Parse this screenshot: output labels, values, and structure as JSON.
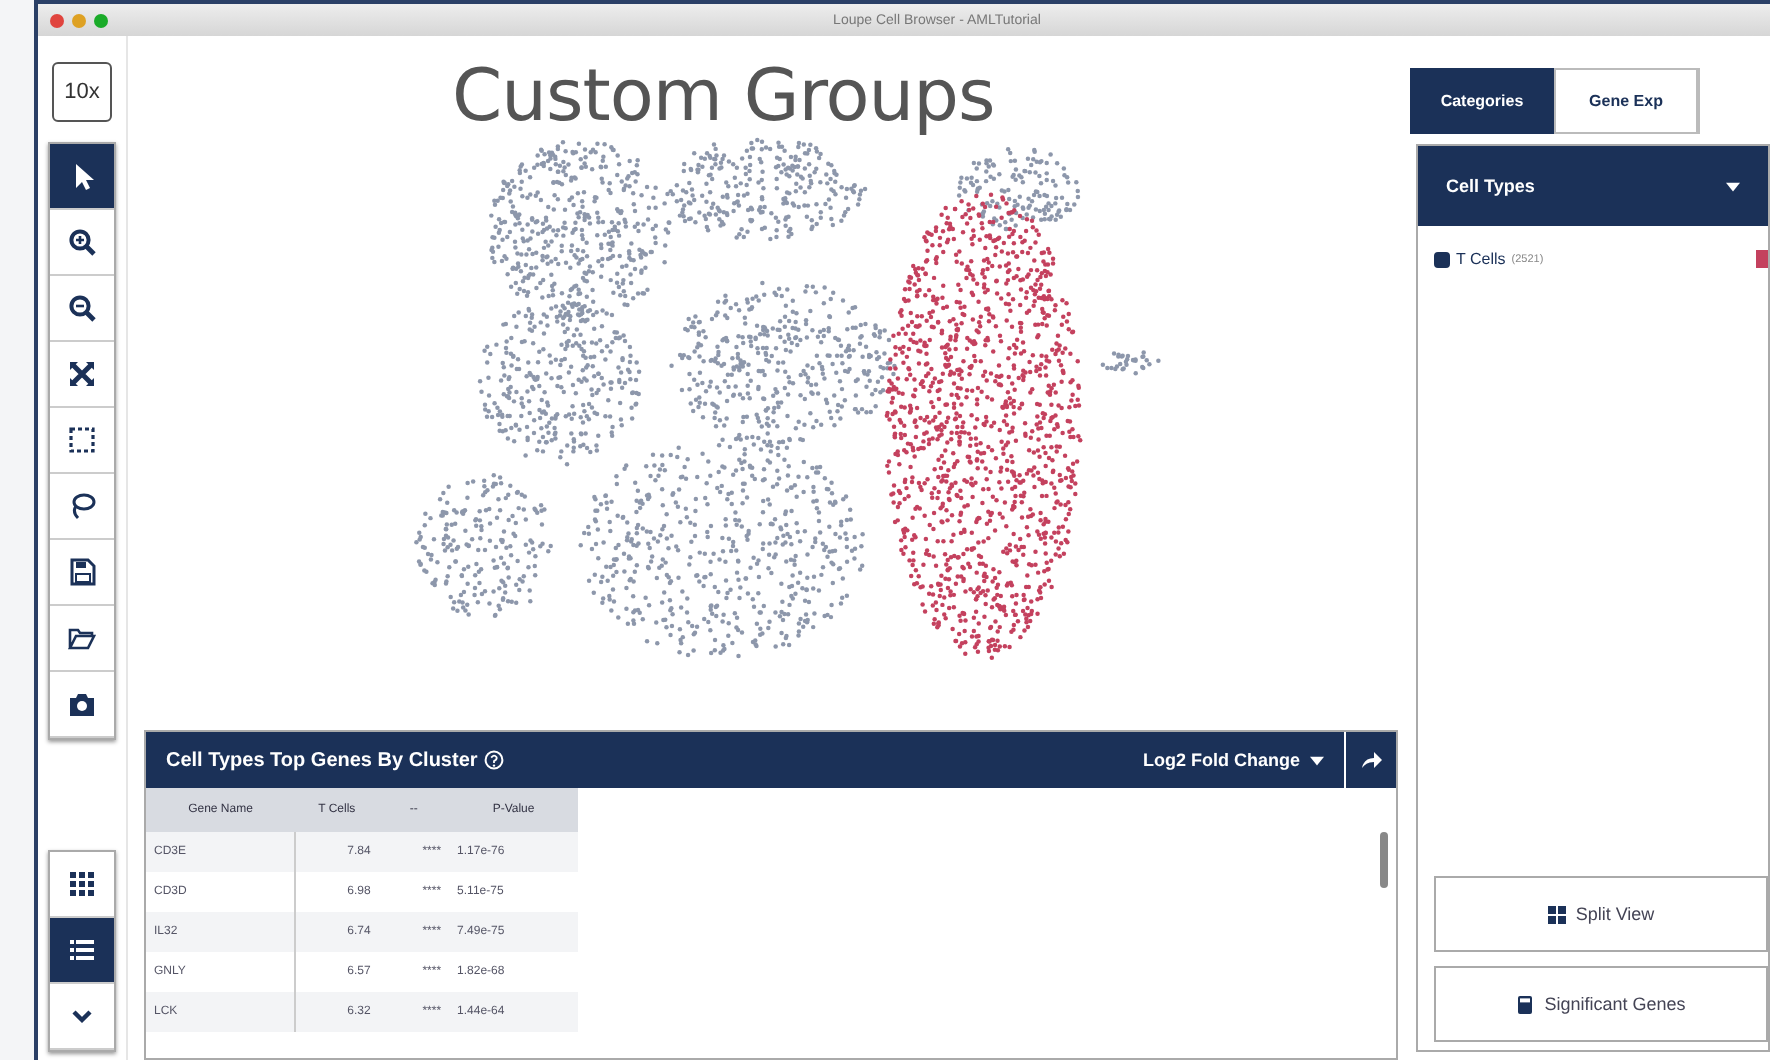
{
  "window": {
    "title": "Loupe Cell Browser - AMLTutorial"
  },
  "overlay_title": "Custom Groups",
  "logo": {
    "text": "10x"
  },
  "toolbar": {
    "tools": [
      {
        "kind": "pointer",
        "selected": true
      },
      {
        "kind": "zoom-in",
        "selected": false
      },
      {
        "kind": "zoom-out",
        "selected": false
      },
      {
        "kind": "fit",
        "selected": false
      },
      {
        "kind": "box-select",
        "selected": false
      },
      {
        "kind": "lasso",
        "selected": false
      },
      {
        "kind": "save",
        "selected": false
      },
      {
        "kind": "open",
        "selected": false
      },
      {
        "kind": "camera",
        "selected": false
      }
    ],
    "view_buttons": [
      {
        "kind": "grid",
        "selected": false
      },
      {
        "kind": "list",
        "selected": true
      },
      {
        "kind": "chevron",
        "selected": false
      }
    ]
  },
  "table_panel": {
    "title": "Cell Types Top Genes By Cluster",
    "metric": "Log2 Fold Change",
    "columns": [
      "Gene Name",
      "T Cells",
      "--",
      "P-Value"
    ],
    "rows": [
      {
        "gene": "CD3E",
        "value": "7.84",
        "stars": "****",
        "p_value": "1.17e-76"
      },
      {
        "gene": "CD3D",
        "value": "6.98",
        "stars": "****",
        "p_value": "5.11e-75"
      },
      {
        "gene": "IL32",
        "value": "6.74",
        "stars": "****",
        "p_value": "7.49e-75"
      },
      {
        "gene": "GNLY",
        "value": "6.57",
        "stars": "****",
        "p_value": "1.82e-68"
      },
      {
        "gene": "LCK",
        "value": "6.32",
        "stars": "****",
        "p_value": "1.44e-64"
      }
    ]
  },
  "right_panel": {
    "tabs": [
      {
        "label": "Categories",
        "selected": true
      },
      {
        "label": "Gene Exp",
        "selected": false
      }
    ],
    "category": "Cell Types",
    "groups": [
      {
        "label": "T Cells",
        "count": "(2521)",
        "checked": true,
        "color": "#c4415e"
      }
    ],
    "buttons": [
      {
        "kind": "split",
        "label": "Split View"
      },
      {
        "kind": "genes",
        "label": "Significant Genes"
      }
    ]
  }
}
